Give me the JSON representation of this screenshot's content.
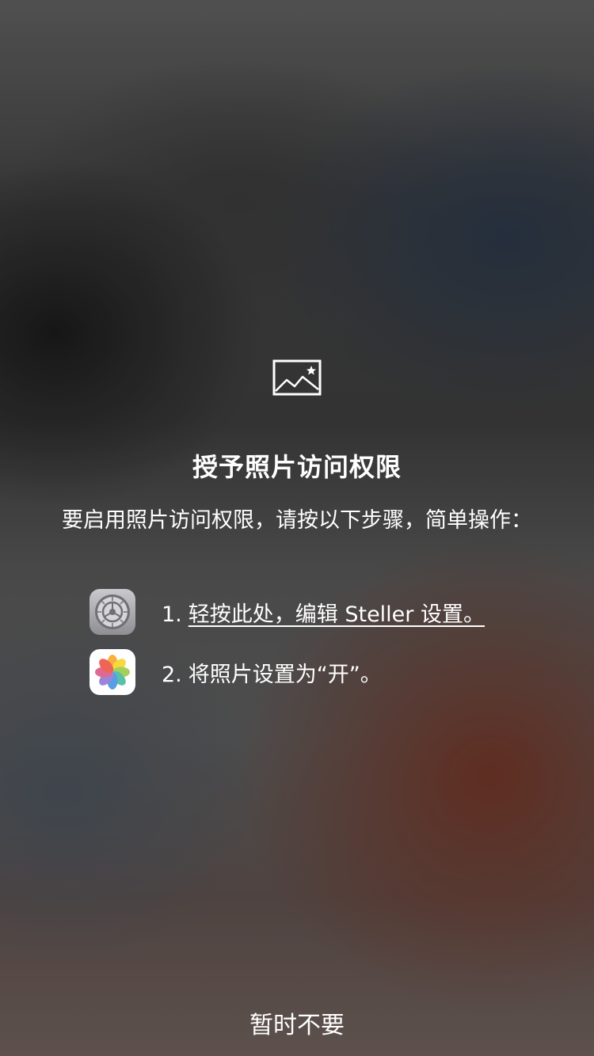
{
  "permission": {
    "title": "授予照片访问权限",
    "description": "要启用照片访问权限，请按以下步骤，简单操作：",
    "icon": "photo-permission-icon",
    "steps": [
      {
        "number": "1.",
        "text": "轻按此处，编辑 Steller 设置。",
        "icon": "settings-app-icon",
        "is_link": true
      },
      {
        "number": "2.",
        "text": "将照片设置为“开”。",
        "icon": "photos-app-icon",
        "is_link": false
      }
    ],
    "dismiss_label": "暂时不要"
  },
  "colors": {
    "text": "#ffffff"
  }
}
